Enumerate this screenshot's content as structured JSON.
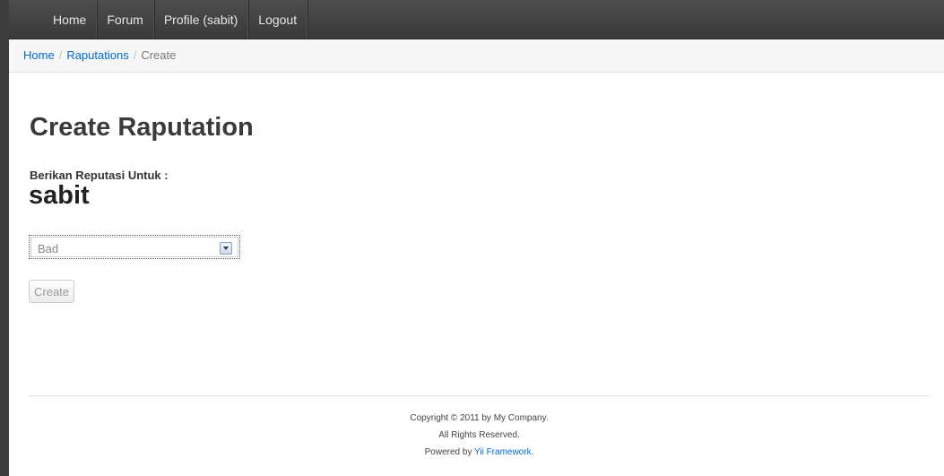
{
  "navbar": {
    "items": [
      {
        "label": "Home"
      },
      {
        "label": "Forum"
      },
      {
        "label": "Profile (sabit)"
      },
      {
        "label": "Logout"
      }
    ]
  },
  "breadcrumb": {
    "home": "Home",
    "separator": "/",
    "section": "Raputations",
    "current": "Create"
  },
  "main": {
    "title": "Create Raputation",
    "label": "Berikan Reputasi Untuk :",
    "username": "sabit",
    "select": {
      "value": "Bad"
    },
    "create_button": "Create"
  },
  "footer": {
    "copyright": "Copyright © 2011 by My Company.",
    "rights": "All Rights Reserved.",
    "powered_prefix": "Powered by ",
    "powered_link": "Yii Framework",
    "powered_suffix": "."
  },
  "colors": {
    "navbar": "#3a3a3a",
    "link": "#0069d6",
    "breadcrumb_bg": "#f7f7f7"
  }
}
